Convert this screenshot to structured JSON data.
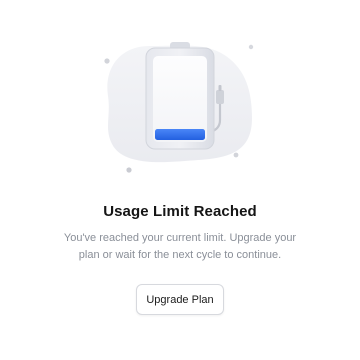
{
  "empty_state": {
    "title": "Usage Limit Reached",
    "message_line_1": "You've reached your current limit. Upgrade your",
    "message_line_2": "plan or wait for the next cycle to continue.",
    "primary_action_label": "Upgrade Plan"
  },
  "illustration": {
    "icon": "battery-low-icon",
    "battery_level_percent": 10
  },
  "colors": {
    "accent": "#2f6fed",
    "background_blob": "#eff0f4",
    "title": "#151515",
    "message": "#8a8f98",
    "button_border": "#d7d9de"
  }
}
